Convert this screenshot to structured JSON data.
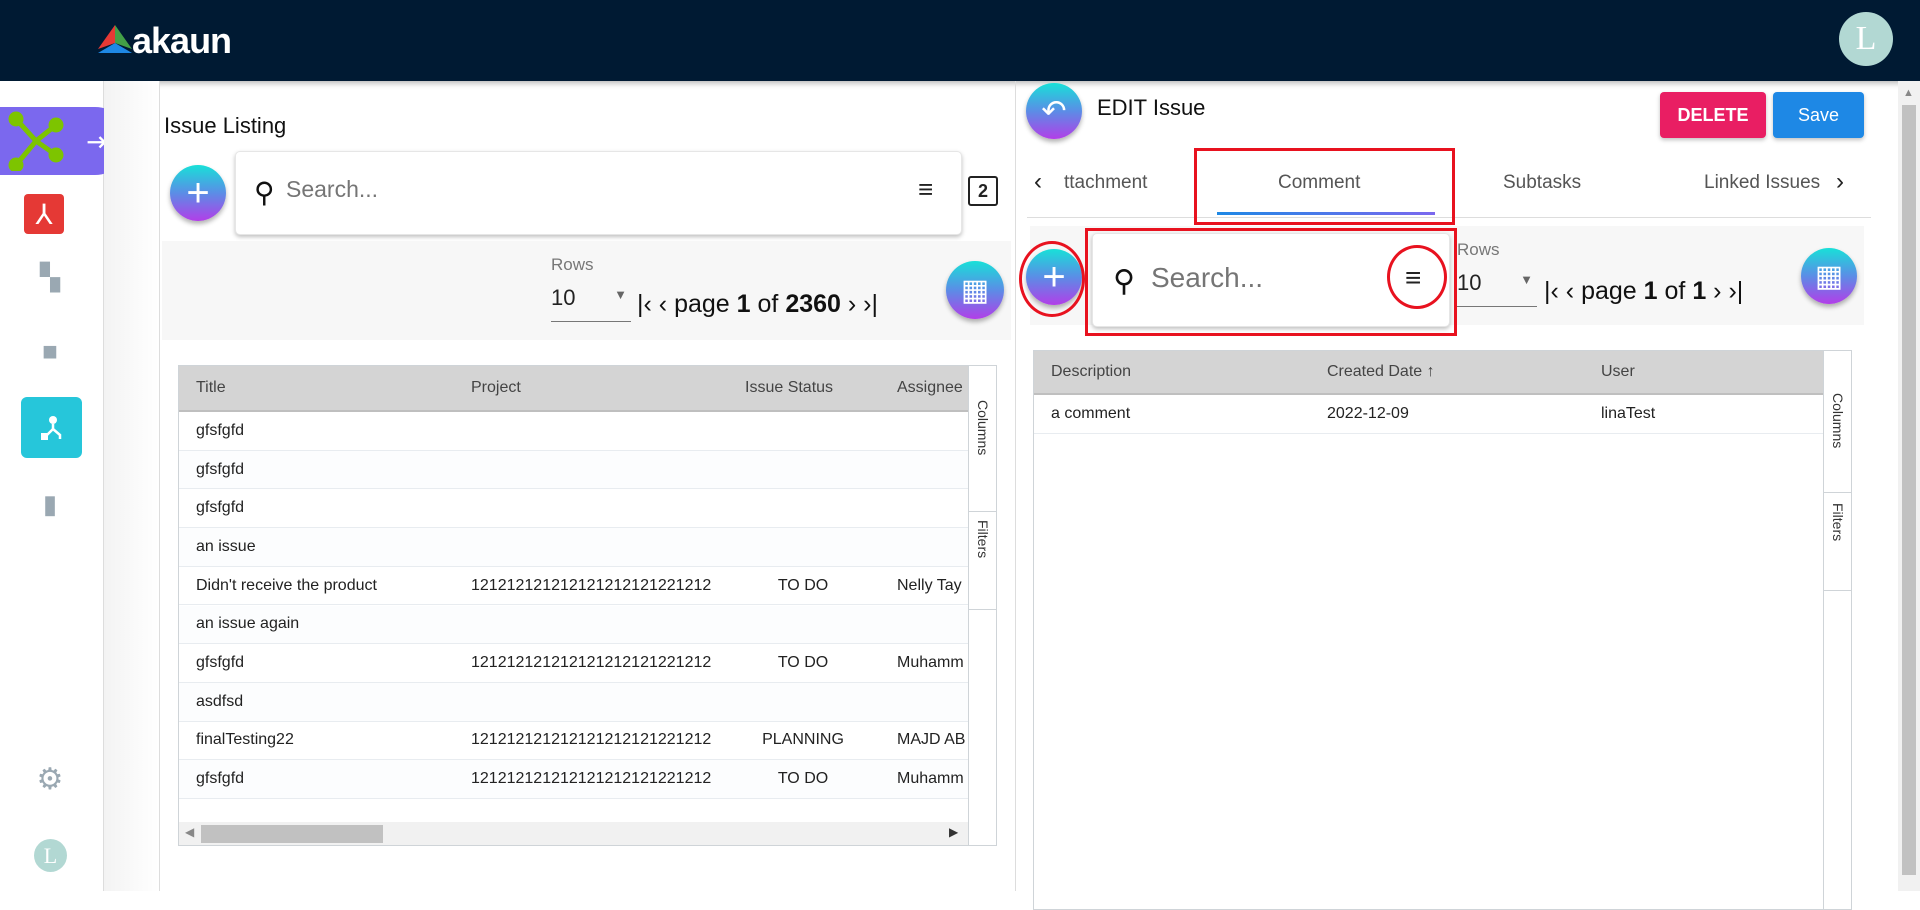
{
  "header": {
    "logo": "akaun",
    "avatar_letter": "L"
  },
  "sidebar": {
    "items": [
      "network-app",
      "acrobat",
      "dashboard",
      "briefcase",
      "issues",
      "reports",
      "settings",
      "user-avatar"
    ]
  },
  "left": {
    "title": "Issue Listing",
    "search_placeholder": "Search...",
    "rows_label": "Rows",
    "rows_value": "10",
    "pager": {
      "page_word": "page",
      "page": "1",
      "of": "of",
      "total": "2360"
    },
    "table": {
      "columns": [
        "Title",
        "Project",
        "Issue Status",
        "Assignee"
      ],
      "rows": [
        [
          "gfsfgfd",
          "",
          "",
          ""
        ],
        [
          "gfsfgfd",
          "",
          "",
          ""
        ],
        [
          "gfsfgfd",
          "",
          "",
          ""
        ],
        [
          "an issue",
          "",
          "",
          ""
        ],
        [
          "Didn't receive the product",
          "121212121212121212121221212",
          "TO DO",
          "Nelly Tay"
        ],
        [
          "an issue again",
          "",
          "",
          ""
        ],
        [
          "gfsfgfd",
          "121212121212121212121221212",
          "TO DO",
          "Muhamm"
        ],
        [
          "asdfsd",
          "",
          "",
          ""
        ],
        [
          "finalTesting22",
          "121212121212121212121221212",
          "PLANNING",
          "MAJD AB"
        ],
        [
          "gfsfgfd",
          "121212121212121212121221212",
          "TO DO",
          "Muhamm"
        ]
      ],
      "side_columns": "Columns",
      "side_filters": "Filters"
    }
  },
  "right": {
    "title": "EDIT Issue",
    "delete_label": "DELETE",
    "save_label": "Save",
    "tabs": [
      "ttachment",
      "Comment",
      "Subtasks",
      "Linked Issues"
    ],
    "active_tab": "Comment",
    "search_placeholder": "Search...",
    "rows_label": "Rows",
    "rows_value": "10",
    "pager": {
      "page_word": "page",
      "page": "1",
      "of": "of",
      "total": "1"
    },
    "table": {
      "columns": [
        "Description",
        "Created Date ↑",
        "User"
      ],
      "rows": [
        [
          "a comment",
          "2022-12-09",
          "linaTest"
        ]
      ],
      "side_columns": "Columns",
      "side_filters": "Filters"
    }
  },
  "colors": {
    "topbar": "#001a33",
    "delete": "#e91e63",
    "save": "#1e88e5",
    "active_nav": "#26c6da",
    "highlight": "#e8121f"
  }
}
